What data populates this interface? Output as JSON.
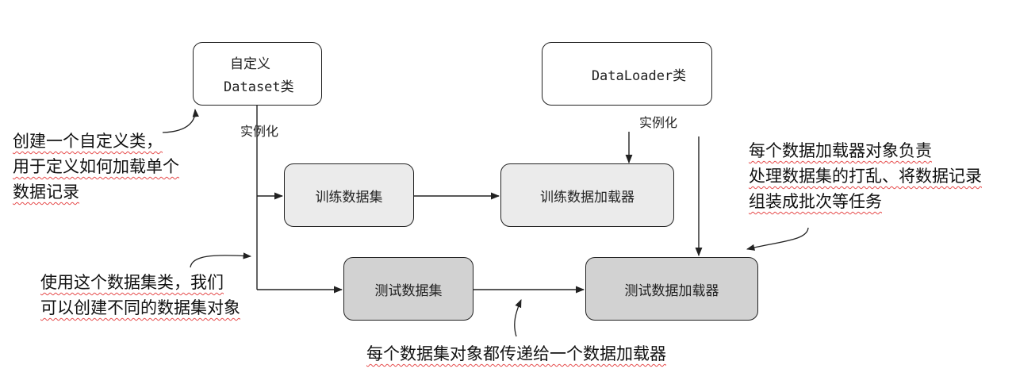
{
  "boxes": {
    "custom_dataset_line1": "自定义",
    "custom_dataset_line2": "Dataset类",
    "dataloader": "DataLoader类",
    "train_dataset": "训练数据集",
    "train_loader": "训练数据加载器",
    "test_dataset": "测试数据集",
    "test_loader": "测试数据加载器"
  },
  "labels": {
    "instantiate_left": "实例化",
    "instantiate_right": "实例化"
  },
  "notes": {
    "custom_class": [
      "创建一个自定义类，",
      "用于定义如何加载单个",
      "数据记录"
    ],
    "dataset_objects": [
      "使用这个数据集类，我们",
      "可以创建不同的数据集对象"
    ],
    "loader_role": [
      "每个数据加载器对象负责",
      "处理数据集的打乱、将数据记录",
      "组装成批次等任务"
    ],
    "pass_to_loader": [
      "每个数据集对象都传递给一个数据加载器"
    ]
  }
}
